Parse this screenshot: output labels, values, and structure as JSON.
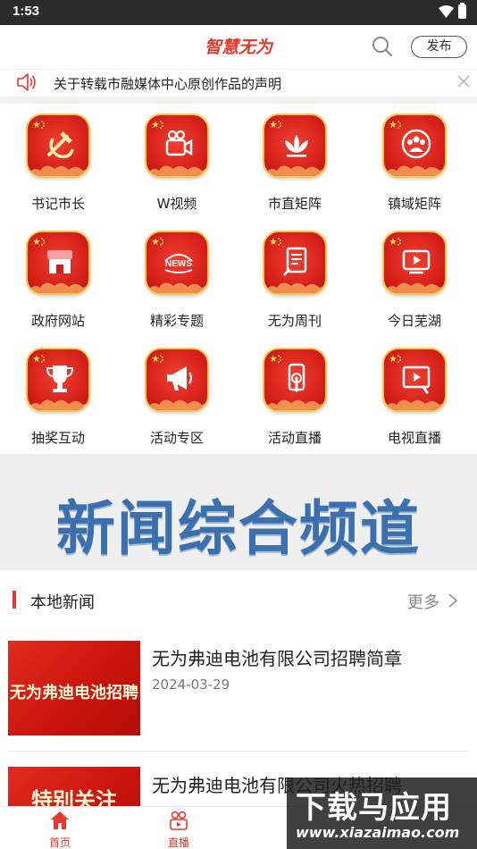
{
  "status_bar": {
    "time": "1:53"
  },
  "header": {
    "title": "智慧无为",
    "publish_label": "发布"
  },
  "notice": {
    "text": "关于转载市融媒体中心原创作品的声明"
  },
  "grid": {
    "items": [
      {
        "label": "书记市长",
        "icon": "hammer-sickle-icon"
      },
      {
        "label": "W视频",
        "icon": "video-camera-icon"
      },
      {
        "label": "市直矩阵",
        "icon": "lotus-icon"
      },
      {
        "label": "镇域矩阵",
        "icon": "group-icon"
      },
      {
        "label": "政府网站",
        "icon": "storefront-icon"
      },
      {
        "label": "精彩专题",
        "icon": "news-icon"
      },
      {
        "label": "无为周刊",
        "icon": "document-edit-icon"
      },
      {
        "label": "今日芜湖",
        "icon": "tv-play-icon"
      },
      {
        "label": "抽奖互动",
        "icon": "trophy-icon"
      },
      {
        "label": "活动专区",
        "icon": "megaphone-icon"
      },
      {
        "label": "活动直播",
        "icon": "phone-touch-icon"
      },
      {
        "label": "电视直播",
        "icon": "film-play-icon"
      }
    ]
  },
  "banner": {
    "title": "新闻综合频道"
  },
  "local_news": {
    "title": "本地新闻",
    "more_label": "更多",
    "items": [
      {
        "headline": "无为弗迪电池有限公司招聘简章",
        "date": "2024-03-29",
        "thumb_text": "无为弗迪电池招聘"
      },
      {
        "headline": "无为弗迪电池有限公司火热招聘",
        "date": "",
        "thumb_text": "特别关注"
      }
    ]
  },
  "tabbar": {
    "items": [
      {
        "label": "首页",
        "icon": "home-icon"
      },
      {
        "label": "直播",
        "icon": "live-video-icon"
      }
    ]
  },
  "watermark": {
    "line1": "下载马应用",
    "line2": "www.xiazaimao.com"
  },
  "colors": {
    "accent": "#e8382c",
    "badge_red": "#d41d18",
    "badge_gold": "#f4c94a",
    "banner_blue": "#3c6fae"
  }
}
